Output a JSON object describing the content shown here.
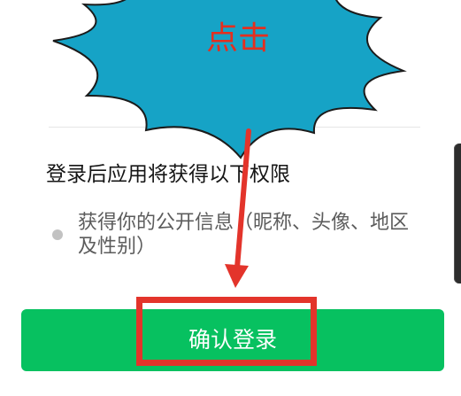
{
  "callout": {
    "text": "点击"
  },
  "permissions": {
    "heading": "登录后应用将获得以下权限",
    "items": [
      {
        "icon": "bullet-dot-icon",
        "text": "获得你的公开信息（昵称、头像、地区及性别）"
      }
    ]
  },
  "confirm_button": {
    "label": "确认登录"
  },
  "colors": {
    "button_green": "#07C160",
    "callout_fill": "#16A3C6",
    "callout_text": "#E42F1F",
    "annotation_red": "#E3342B"
  }
}
